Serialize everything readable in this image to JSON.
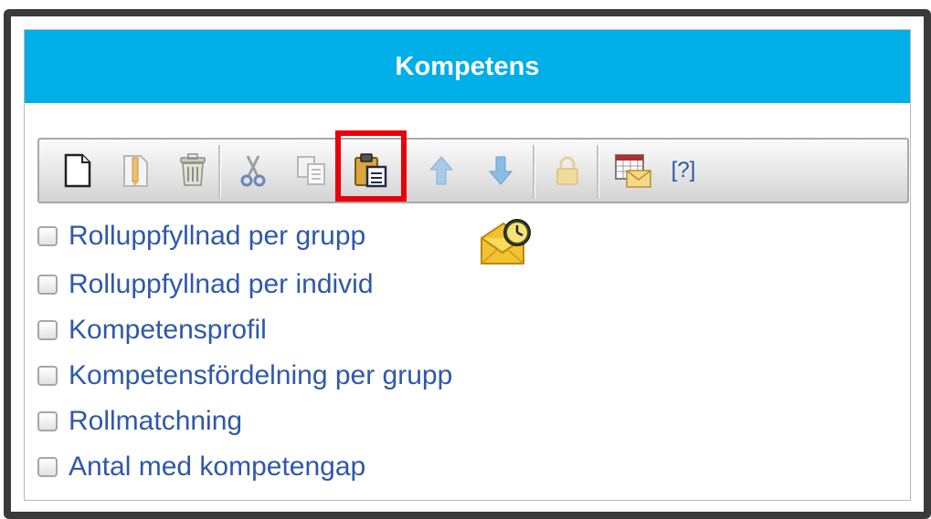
{
  "panel": {
    "title": "Kompetens"
  },
  "toolbar": {
    "buttons": [
      {
        "name": "new-document",
        "icon": "new-document-icon"
      },
      {
        "name": "edit",
        "icon": "edit-icon"
      },
      {
        "name": "delete",
        "icon": "trash-icon"
      },
      {
        "name": "cut",
        "icon": "scissors-icon"
      },
      {
        "name": "copy",
        "icon": "copy-icon"
      },
      {
        "name": "paste",
        "icon": "paste-icon",
        "highlighted": true
      },
      {
        "name": "move-up",
        "icon": "arrow-up-icon"
      },
      {
        "name": "move-down",
        "icon": "arrow-down-icon"
      },
      {
        "name": "lock",
        "icon": "lock-icon"
      },
      {
        "name": "schedule-email",
        "icon": "calendar-email-icon"
      }
    ],
    "help_label": "[?]"
  },
  "reports": [
    {
      "label": "Rolluppfyllnad per grupp",
      "checked": false
    },
    {
      "label": "Rolluppfyllnad per individ",
      "checked": false
    },
    {
      "label": "Kompetensprofil",
      "checked": false
    },
    {
      "label": "Kompetensfördelning per grupp",
      "checked": false
    },
    {
      "label": "Rollmatchning",
      "checked": false
    },
    {
      "label": "Antal med kompetengap",
      "checked": false
    }
  ],
  "colors": {
    "header": "#00aee8",
    "link": "#2f58a8",
    "highlight": "#e8000b"
  }
}
